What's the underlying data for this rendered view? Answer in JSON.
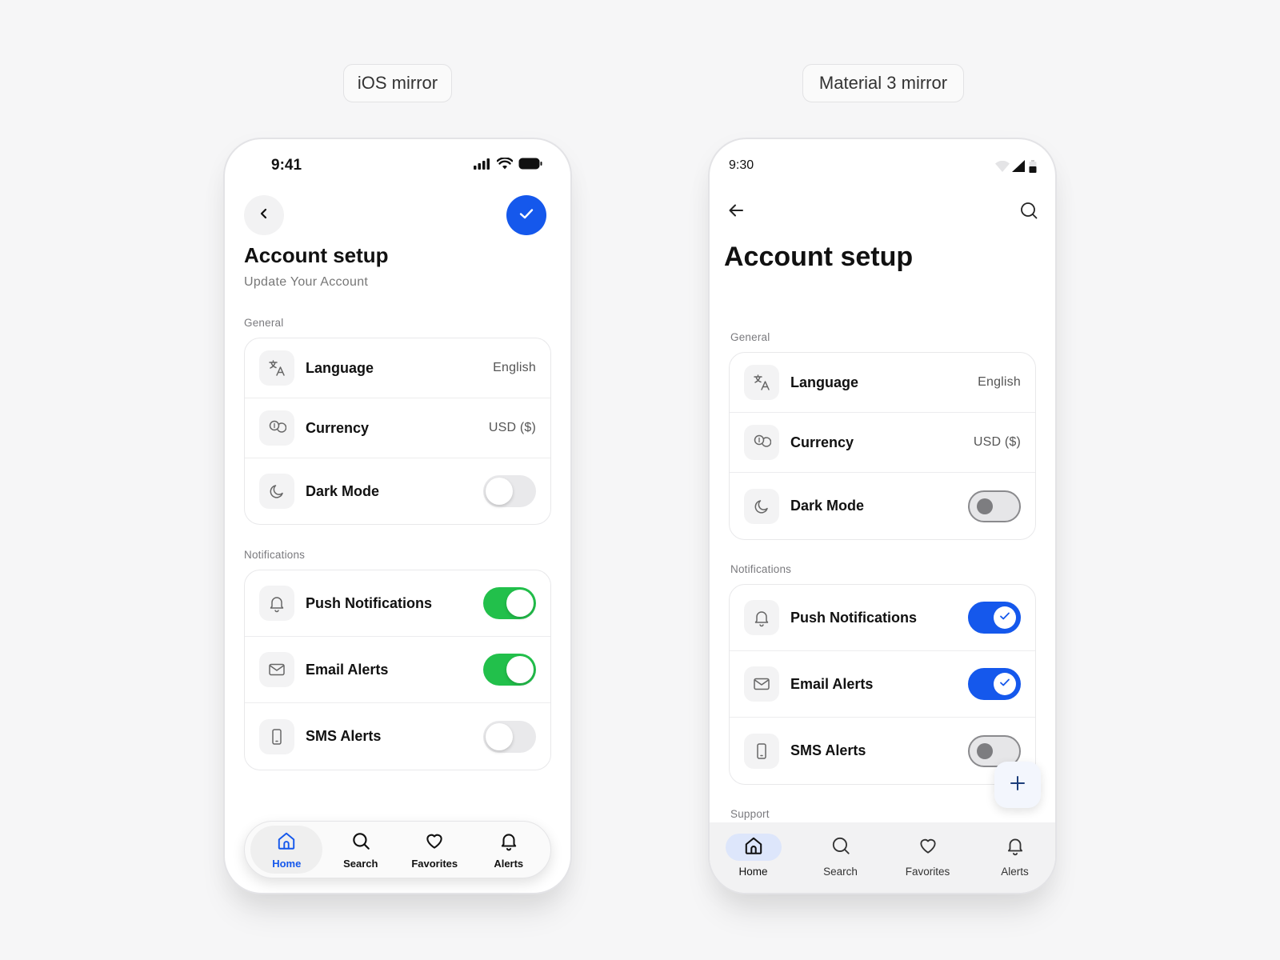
{
  "labels": {
    "ios": "iOS mirror",
    "material": "Material 3 mirror"
  },
  "ios": {
    "status_time": "9:41",
    "title": "Account setup",
    "subtitle": "Update Your Account",
    "general_label": "General",
    "notifications_label": "Notifications",
    "general_rows": [
      {
        "label": "Language",
        "value": "English",
        "icon": "translate-icon"
      },
      {
        "label": "Currency",
        "value": "USD ($)",
        "icon": "coins-icon"
      },
      {
        "label": "Dark Mode",
        "icon": "moon-icon",
        "toggle": false
      }
    ],
    "notification_rows": [
      {
        "label": "Push Notifications",
        "icon": "bell-icon",
        "toggle": true
      },
      {
        "label": "Email Alerts",
        "icon": "mail-icon",
        "toggle": true
      },
      {
        "label": "SMS Alerts",
        "icon": "phone-icon",
        "toggle": false
      }
    ],
    "tabs": [
      {
        "label": "Home",
        "icon": "home-icon",
        "active": true
      },
      {
        "label": "Search",
        "icon": "search-icon",
        "active": false
      },
      {
        "label": "Favorites",
        "icon": "heart-icon",
        "active": false
      },
      {
        "label": "Alerts",
        "icon": "bell-icon",
        "active": false
      }
    ],
    "colors": {
      "accent": "#1558ec",
      "toggle_on": "#22c04b"
    }
  },
  "material": {
    "status_time": "9:30",
    "title": "Account setup",
    "general_label": "General",
    "notifications_label": "Notifications",
    "support_label": "Support",
    "general_rows": [
      {
        "label": "Language",
        "value": "English",
        "icon": "translate-icon"
      },
      {
        "label": "Currency",
        "value": "USD ($)",
        "icon": "coins-icon"
      },
      {
        "label": "Dark Mode",
        "icon": "moon-icon",
        "toggle": false
      }
    ],
    "notification_rows": [
      {
        "label": "Push Notifications",
        "icon": "bell-icon",
        "toggle": true
      },
      {
        "label": "Email Alerts",
        "icon": "mail-icon",
        "toggle": true
      },
      {
        "label": "SMS Alerts",
        "icon": "phone-icon",
        "toggle": false
      }
    ],
    "tabs": [
      {
        "label": "Home",
        "icon": "home-icon",
        "active": true
      },
      {
        "label": "Search",
        "icon": "search-icon",
        "active": false
      },
      {
        "label": "Favorites",
        "icon": "heart-icon",
        "active": false
      },
      {
        "label": "Alerts",
        "icon": "bell-icon",
        "active": false
      }
    ],
    "colors": {
      "accent": "#1558ec",
      "indicator": "#dde6fb"
    }
  }
}
